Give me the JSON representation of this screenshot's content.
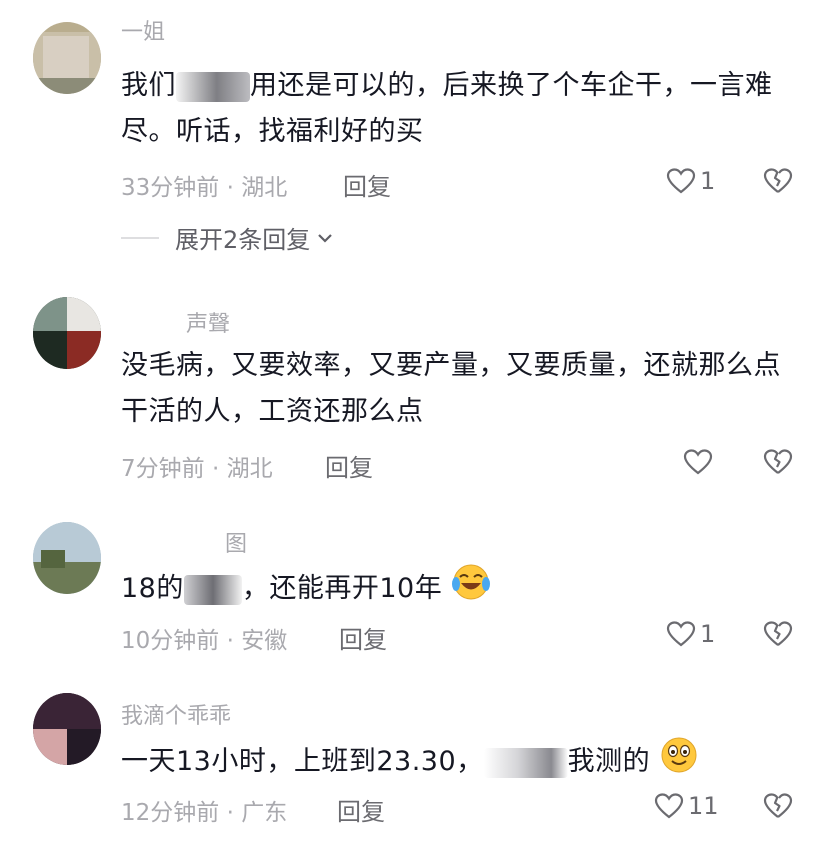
{
  "comments": [
    {
      "username": "一姐",
      "text_before": "我们",
      "text_after": "用还是可以的，后来换了个车企干，一言难尽。听话，找福利好的买",
      "time": "33分钟前",
      "location": "湖北",
      "reply_label": "回复",
      "likes": "1"
    },
    {
      "username": "声聲",
      "text": "没毛病，又要效率，又要产量，又要质量，还就那么点干活的人，工资还那么点",
      "time": "7分钟前",
      "location": "湖北",
      "reply_label": "回复",
      "likes": ""
    },
    {
      "username": "图",
      "text_before": "18的",
      "text_after": "，还能再开10年",
      "time": "10分钟前",
      "location": "安徽",
      "reply_label": "回复",
      "likes": "1"
    },
    {
      "username": "我滴个乖乖",
      "text_before": "一天13小时，上班到23.30，",
      "text_after": "我测的",
      "time": "12分钟前",
      "location": "广东",
      "reply_label": "回复",
      "likes": "11"
    }
  ],
  "expand_replies_label": "展开2条回复",
  "meta_separator": "·",
  "colors": {
    "text": "#161823",
    "meta": "#a9a9ae",
    "icon": "#6b6b70"
  }
}
